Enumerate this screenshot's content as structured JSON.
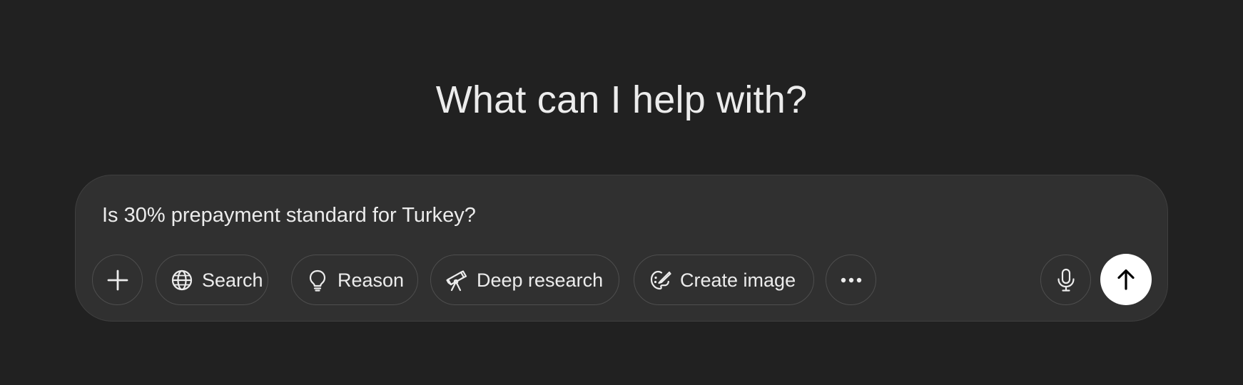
{
  "heading": "What can I help with?",
  "composer": {
    "prompt_value": "Is 30% prepayment standard for Turkey?"
  },
  "toolbar": {
    "attach_icon": "plus-icon",
    "search_label": "Search",
    "search_icon": "globe-icon",
    "reason_label": "Reason",
    "reason_icon": "lightbulb-icon",
    "deep_research_label": "Deep research",
    "deep_research_icon": "telescope-icon",
    "create_image_label": "Create image",
    "create_image_icon": "palette-icon",
    "more_icon": "ellipsis-icon",
    "voice_icon": "microphone-icon",
    "send_icon": "arrow-up-icon"
  },
  "colors": {
    "background": "#212121",
    "composer_bg": "#303030",
    "text": "#ececec",
    "send_bg": "#ffffff"
  }
}
